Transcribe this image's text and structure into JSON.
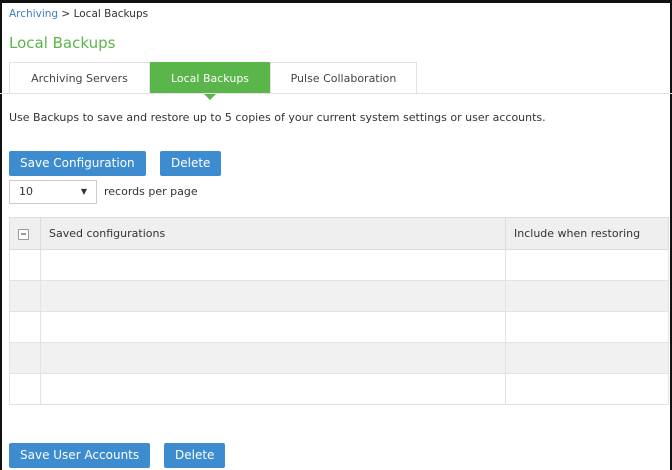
{
  "breadcrumb": {
    "parent": "Archiving",
    "separator": ">",
    "current": "Local Backups"
  },
  "page_title": "Local Backups",
  "tabs": [
    {
      "label": "Archiving Servers",
      "active": false
    },
    {
      "label": "Local Backups",
      "active": true
    },
    {
      "label": "Pulse Collaboration",
      "active": false
    }
  ],
  "description": "Use Backups to save and restore up to 5 copies of your current system settings or user accounts.",
  "config_actions": {
    "save_label": "Save Configuration",
    "delete_label": "Delete"
  },
  "paging": {
    "selected": "10",
    "suffix": "records per page"
  },
  "table": {
    "select_all_icon": "checkbox-icon",
    "columns": [
      "Saved configurations",
      "Include when restoring"
    ],
    "rows": [
      [
        "",
        ""
      ],
      [
        "",
        ""
      ],
      [
        "",
        ""
      ],
      [
        "",
        ""
      ],
      [
        "",
        ""
      ]
    ]
  },
  "user_actions": {
    "save_label": "Save User Accounts",
    "delete_label": "Delete"
  },
  "colors": {
    "accent_green": "#5ab54a",
    "button_blue": "#3d8cd0",
    "link_blue": "#3d7fc1"
  }
}
